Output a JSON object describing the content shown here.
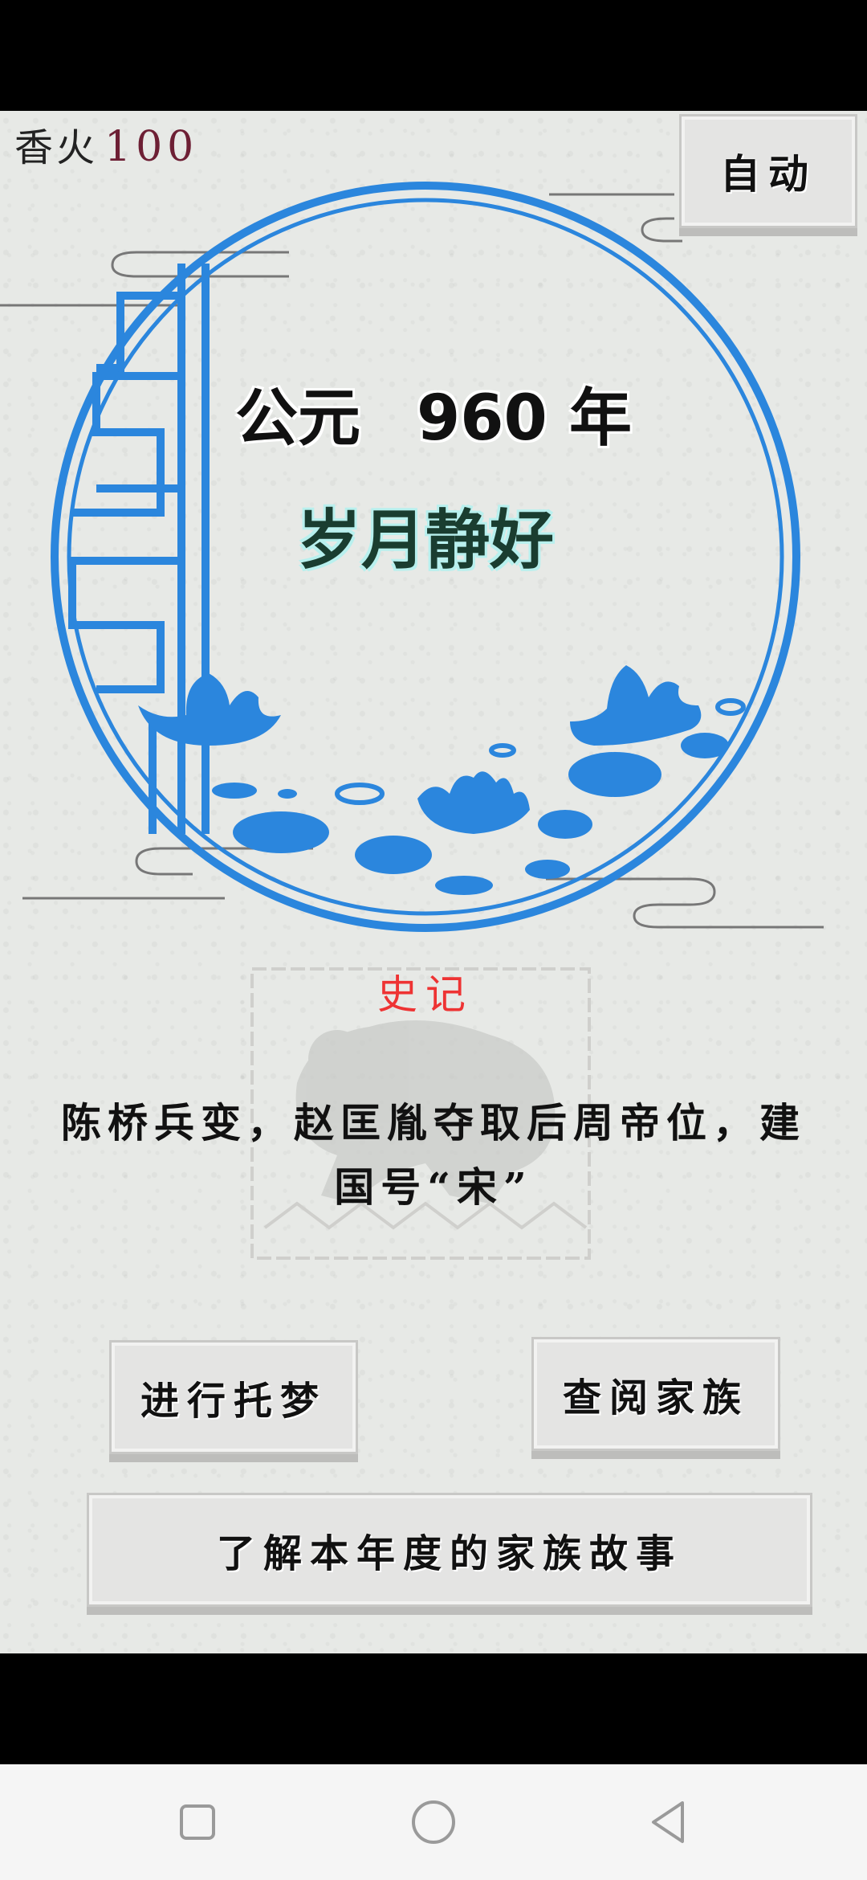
{
  "hud": {
    "incense_label": "香火",
    "incense_value": "100"
  },
  "buttons": {
    "auto": "自动",
    "dream": "进行托梦",
    "family": "查阅家族",
    "story": "了解本年度的家族故事"
  },
  "era": {
    "year_text": "公元",
    "year_number": "960",
    "year_unit": "年",
    "mood": "岁月静好"
  },
  "record": {
    "title": "史记",
    "text": "陈桥兵变，赵匡胤夺取后周帝位，建国号“宋”"
  },
  "nav": {
    "recent": "square-icon",
    "home": "circle-icon",
    "back": "triangle-back-icon"
  },
  "colors": {
    "ring": "#2b86dd",
    "incense_value": "#6d1f34",
    "record_title": "#ee3333"
  }
}
